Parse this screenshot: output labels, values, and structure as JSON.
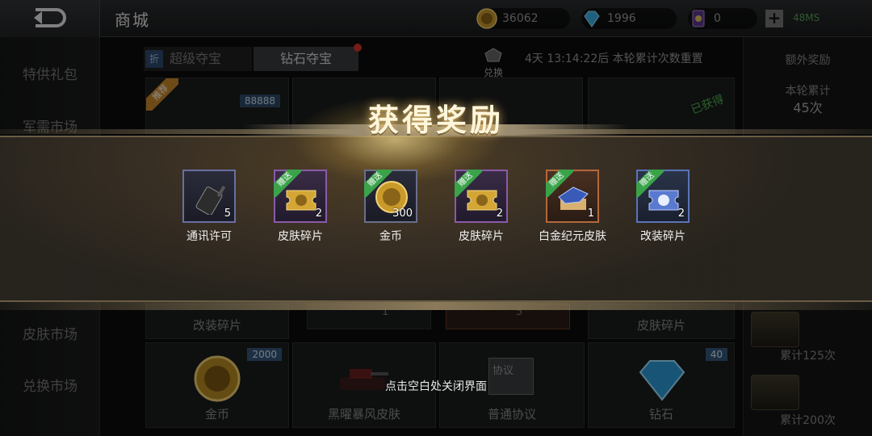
{
  "header": {
    "title": "商城",
    "coins": "36062",
    "diamonds": "1996",
    "tickets": "0",
    "ping": "48MS"
  },
  "sidebar": {
    "items": [
      {
        "label": "特供礼包"
      },
      {
        "label": "军需市场"
      },
      {
        "label": "皮肤市场"
      },
      {
        "label": "兑换市场"
      }
    ]
  },
  "shop": {
    "tab_discount_badge": "折",
    "tab_super": "超级夺宝",
    "tab_diamond": "钻石夺宝",
    "exchange_label": "兑换",
    "timer_text": "4天 13:14:22后 本轮累计次数重置",
    "recommend_badge": "推荐",
    "top_left_qty": "88888",
    "obtained_label": "已获得",
    "row2": [
      {
        "label": "改装碎片"
      },
      {
        "qty": "1"
      },
      {
        "qty": "5"
      },
      {
        "label": "皮肤碎片"
      }
    ],
    "row3": [
      {
        "label": "金币",
        "qty": "2000"
      },
      {
        "label": "黑曜暴风皮肤"
      },
      {
        "label": "普通协议",
        "tag": "协议"
      },
      {
        "label": "钻石",
        "qty": "40"
      }
    ]
  },
  "right_panel": {
    "title": "额外奖励",
    "cum_label": "本轮累计",
    "cum_count": "45次",
    "milestones": [
      {
        "label": "累计125次"
      },
      {
        "label": "累计200次"
      }
    ]
  },
  "reward_popup": {
    "title": "获得奖励",
    "gift_tag": "赠送",
    "close_hint": "点击空白处关闭界面",
    "items": [
      {
        "name": "通讯许可",
        "count": "5",
        "icon": "walkie-talkie-icon",
        "gift": false
      },
      {
        "name": "皮肤碎片",
        "count": "2",
        "icon": "skin-shard-icon",
        "gift": true
      },
      {
        "name": "金币",
        "count": "300",
        "icon": "gold-coin-icon",
        "gift": true
      },
      {
        "name": "皮肤碎片",
        "count": "2",
        "icon": "skin-shard-icon",
        "gift": true
      },
      {
        "name": "白金纪元皮肤",
        "count": "1",
        "icon": "tank-skin-icon",
        "gift": true
      },
      {
        "name": "改装碎片",
        "count": "2",
        "icon": "mod-shard-icon",
        "gift": true
      }
    ]
  }
}
